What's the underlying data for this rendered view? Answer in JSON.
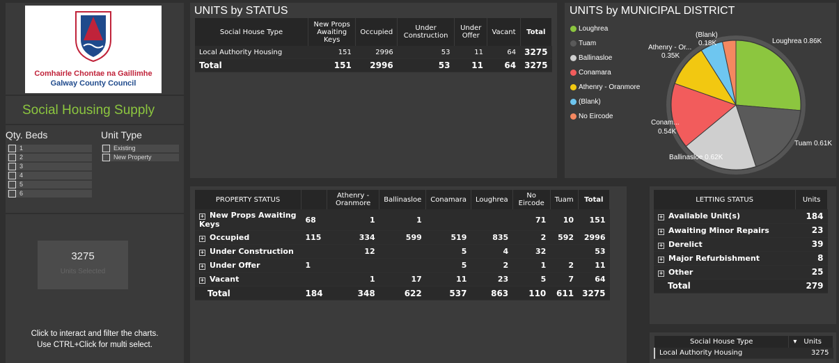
{
  "logo": {
    "line1": "Comhairle Chontae na Gaillimhe",
    "line2": "Galway County Council"
  },
  "page_title": "Social Housing Supply",
  "slicers": {
    "beds_label": "Qty. Beds",
    "beds_options": [
      "1",
      "2",
      "3",
      "4",
      "5",
      "6"
    ],
    "unit_type_label": "Unit Type",
    "unit_type_options": [
      "Existing",
      "New Property"
    ]
  },
  "card": {
    "value": "3275",
    "label": "Units Selected"
  },
  "help_text": {
    "line1": "Click to interact and filter the charts.",
    "line2": "Use CTRL+Click for multi select."
  },
  "units_by_status": {
    "title": "UNITS by STATUS",
    "headers": [
      "Social House Type",
      "New Props Awaiting Keys",
      "Occupied",
      "Under Construction",
      "Under Offer",
      "Vacant",
      "Total"
    ],
    "row": [
      "Local Authority Housing",
      "151",
      "2996",
      "53",
      "11",
      "64",
      "3275"
    ],
    "total": [
      "Total",
      "151",
      "2996",
      "53",
      "11",
      "64",
      "3275"
    ]
  },
  "units_by_district": {
    "title": "UNITS by MUNICIPAL DISTRICT",
    "legend": [
      {
        "name": "Loughrea",
        "color": "#8cc63f"
      },
      {
        "name": "Tuam",
        "color": "#5a5a5a"
      },
      {
        "name": "Ballinasloe",
        "color": "#cfcfcf"
      },
      {
        "name": "Conamara",
        "color": "#f25c5c"
      },
      {
        "name": "Athenry - Oranmore",
        "color": "#f2c811"
      },
      {
        "name": "(Blank)",
        "color": "#6ec6f0"
      },
      {
        "name": "No Eircode",
        "color": "#f58860"
      }
    ],
    "labels": {
      "loughrea": "Loughrea 0.86K",
      "tuam": "Tuam 0.61K",
      "ballinasloe": "Ballinasloe 0.62K",
      "conamara_1": "Conam...",
      "conamara_2": "0.54K",
      "athenry_1": "Athenry - Or...",
      "athenry_2": "0.35K",
      "blank_1": "(Blank)",
      "blank_2": "0.18K"
    }
  },
  "chart_data": {
    "type": "pie",
    "title": "UNITS by MUNICIPAL DISTRICT",
    "categories": [
      "Loughrea",
      "Tuam",
      "Ballinasloe",
      "Conamara",
      "Athenry - Oranmore",
      "(Blank)",
      "No Eircode"
    ],
    "values": [
      863,
      611,
      622,
      537,
      348,
      184,
      110
    ]
  },
  "property_status": {
    "headers": [
      "PROPERTY STATUS",
      "",
      "Athenry - Oranmore",
      "Ballinasloe",
      "Conamara",
      "Loughrea",
      "No Eircode",
      "Tuam",
      "Total"
    ],
    "rows": [
      [
        "New Props Awaiting Keys",
        "68",
        "1",
        "1",
        "",
        "",
        "71",
        "10",
        "151"
      ],
      [
        "Occupied",
        "115",
        "334",
        "599",
        "519",
        "835",
        "2",
        "592",
        "2996"
      ],
      [
        "Under Construction",
        "",
        "12",
        "",
        "5",
        "4",
        "32",
        "",
        "53"
      ],
      [
        "Under Offer",
        "1",
        "",
        "",
        "5",
        "2",
        "1",
        "2",
        "11"
      ],
      [
        "Vacant",
        "",
        "1",
        "17",
        "11",
        "23",
        "5",
        "7",
        "64"
      ]
    ],
    "total": [
      "Total",
      "184",
      "348",
      "622",
      "537",
      "863",
      "110",
      "611",
      "3275"
    ]
  },
  "letting_status": {
    "headers": [
      "LETTING STATUS",
      "Units"
    ],
    "rows": [
      [
        "Available Unit(s)",
        "184"
      ],
      [
        "Awaiting Minor Repairs",
        "23"
      ],
      [
        "Derelict",
        "39"
      ],
      [
        "Major Refurbishment",
        "8"
      ],
      [
        "Other",
        "25"
      ]
    ],
    "total": [
      "Total",
      "279"
    ]
  },
  "bottom_table": {
    "headers": [
      "Social House Type",
      "Units"
    ],
    "row": [
      "Local Authority Housing",
      "3275"
    ]
  }
}
